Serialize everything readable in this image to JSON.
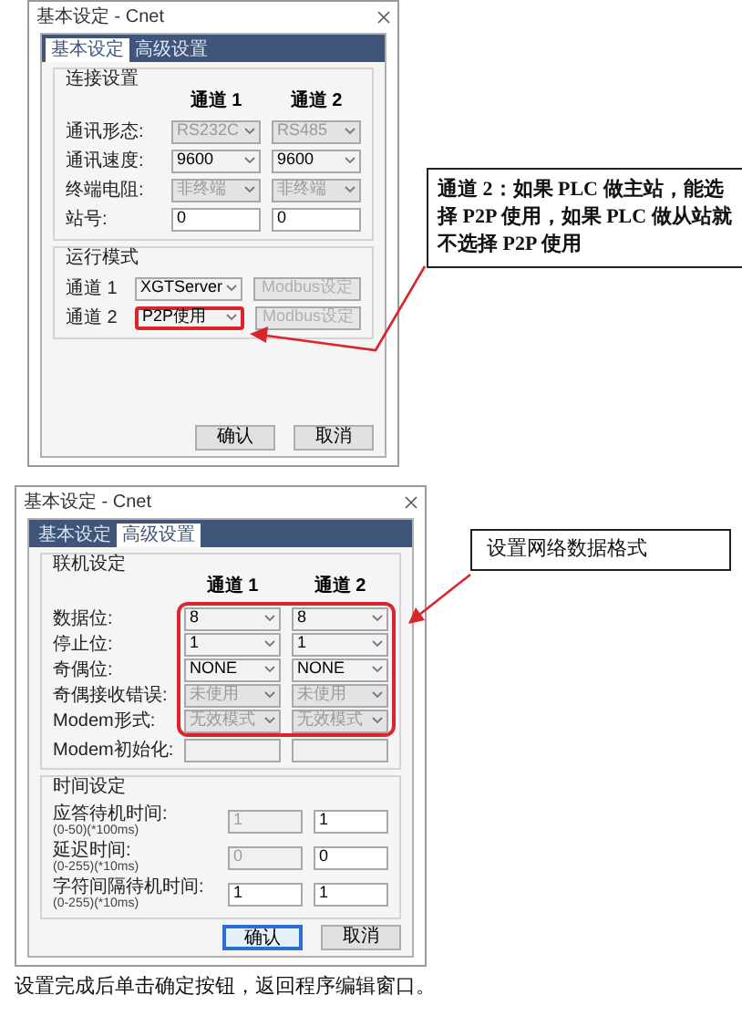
{
  "dialogs": [
    {
      "title": "基本设定 - Cnet",
      "tabs": [
        {
          "label": "基本设定",
          "selected": true
        },
        {
          "label": "高级设置",
          "selected": false
        }
      ],
      "groups": [
        {
          "title": "连接设置",
          "columns": [
            "通道 1",
            "通道 2"
          ],
          "rows": [
            {
              "label": "通讯形态:",
              "highlighted": false,
              "cells": [
                {
                  "kind": "select",
                  "value": "RS232C",
                  "disabled": true,
                  "highlighted": false
                },
                {
                  "kind": "select",
                  "value": "RS485",
                  "disabled": true,
                  "highlighted": false
                }
              ]
            },
            {
              "label": "通讯速度:",
              "highlighted": false,
              "cells": [
                {
                  "kind": "select",
                  "value": "9600",
                  "disabled": false,
                  "highlighted": false
                },
                {
                  "kind": "select",
                  "value": "9600",
                  "disabled": false,
                  "highlighted": false
                }
              ]
            },
            {
              "label": "终端电阻:",
              "highlighted": false,
              "cells": [
                {
                  "kind": "select",
                  "value": "非终端",
                  "disabled": true,
                  "highlighted": false
                },
                {
                  "kind": "select",
                  "value": "非终端",
                  "disabled": true,
                  "highlighted": false
                }
              ]
            },
            {
              "label": "站号:",
              "highlighted": false,
              "cells": [
                {
                  "kind": "input",
                  "value": "0",
                  "disabled": false,
                  "highlighted": false
                },
                {
                  "kind": "input",
                  "value": "0",
                  "disabled": false,
                  "highlighted": false
                }
              ]
            }
          ]
        },
        {
          "title": "运行模式",
          "rows": [
            {
              "label": "通道 1",
              "highlighted": false,
              "cells": [
                {
                  "kind": "select",
                  "value": "XGTServer",
                  "disabled": false,
                  "highlighted": false
                },
                {
                  "kind": "button",
                  "value": "Modbus设定",
                  "disabled": true,
                  "highlighted": false
                }
              ]
            },
            {
              "label": "通道 2",
              "highlighted": false,
              "cells": [
                {
                  "kind": "select",
                  "value": "P2P使用",
                  "disabled": false,
                  "highlighted": true
                },
                {
                  "kind": "button",
                  "value": "Modbus设定",
                  "disabled": true,
                  "highlighted": false
                }
              ]
            }
          ]
        }
      ],
      "buttons": [
        {
          "label": "确认",
          "focused": false
        },
        {
          "label": "取消",
          "focused": false
        }
      ],
      "callout": "通道 2：如果 PLC 做主站，能选择 P2P 使用，如果 PLC 做从站就不选择 P2P 使用"
    },
    {
      "title": "基本设定 - Cnet",
      "tabs": [
        {
          "label": "基本设定",
          "selected": false
        },
        {
          "label": "高级设置",
          "selected": true
        }
      ],
      "groups": [
        {
          "title": "联机设定",
          "columns": [
            "通道 1",
            "通道 2"
          ],
          "rows": [
            {
              "label": "数据位:",
              "highlighted": true,
              "cells": [
                {
                  "kind": "select",
                  "value": "8",
                  "disabled": false,
                  "highlighted": false
                },
                {
                  "kind": "select",
                  "value": "8",
                  "disabled": false,
                  "highlighted": false
                }
              ]
            },
            {
              "label": "停止位:",
              "highlighted": true,
              "cells": [
                {
                  "kind": "select",
                  "value": "1",
                  "disabled": false,
                  "highlighted": false
                },
                {
                  "kind": "select",
                  "value": "1",
                  "disabled": false,
                  "highlighted": false
                }
              ]
            },
            {
              "label": "奇偶位:",
              "highlighted": true,
              "cells": [
                {
                  "kind": "select",
                  "value": "NONE",
                  "disabled": false,
                  "highlighted": false
                },
                {
                  "kind": "select",
                  "value": "NONE",
                  "disabled": false,
                  "highlighted": false
                }
              ]
            },
            {
              "label": "奇偶接收错误:",
              "highlighted": true,
              "cells": [
                {
                  "kind": "select",
                  "value": "未使用",
                  "disabled": true,
                  "highlighted": false
                },
                {
                  "kind": "select",
                  "value": "未使用",
                  "disabled": true,
                  "highlighted": false
                }
              ]
            },
            {
              "label": "Modem形式:",
              "highlighted": true,
              "cells": [
                {
                  "kind": "select",
                  "value": "无效模式",
                  "disabled": true,
                  "highlighted": false
                },
                {
                  "kind": "select",
                  "value": "无效模式",
                  "disabled": true,
                  "highlighted": false
                }
              ]
            },
            {
              "label": "Modem初始化:",
              "highlighted": false,
              "cells": [
                {
                  "kind": "input",
                  "disabled": true,
                  "highlighted": false
                },
                {
                  "kind": "input",
                  "disabled": true,
                  "highlighted": false
                }
              ]
            }
          ]
        },
        {
          "title": "时间设定",
          "rows": [
            {
              "label": "应答待机时间:",
              "sublabel": "(0-50)(*100ms)",
              "highlighted": false,
              "cells": [
                {
                  "kind": "input",
                  "value": "1",
                  "disabled": true,
                  "highlighted": false
                },
                {
                  "kind": "input",
                  "value": "1",
                  "disabled": false,
                  "highlighted": false
                }
              ]
            },
            {
              "label": "延迟时间:",
              "sublabel": "(0-255)(*10ms)",
              "highlighted": false,
              "cells": [
                {
                  "kind": "input",
                  "value": "0",
                  "disabled": true,
                  "highlighted": false
                },
                {
                  "kind": "input",
                  "value": "0",
                  "disabled": false,
                  "highlighted": false
                }
              ]
            },
            {
              "label": "字符间隔待机时间:",
              "sublabel": "(0-255)(*10ms)",
              "highlighted": false,
              "cells": [
                {
                  "kind": "input",
                  "value": "1",
                  "disabled": false,
                  "highlighted": false
                },
                {
                  "kind": "input",
                  "value": "1",
                  "disabled": false,
                  "highlighted": false
                }
              ]
            }
          ]
        }
      ],
      "buttons": [
        {
          "label": "确认",
          "focused": true
        },
        {
          "label": "取消",
          "focused": false
        }
      ],
      "callout": "设置网络数据格式"
    }
  ],
  "caption": "设置完成后单击确定按钮，返回程序编辑窗口。"
}
